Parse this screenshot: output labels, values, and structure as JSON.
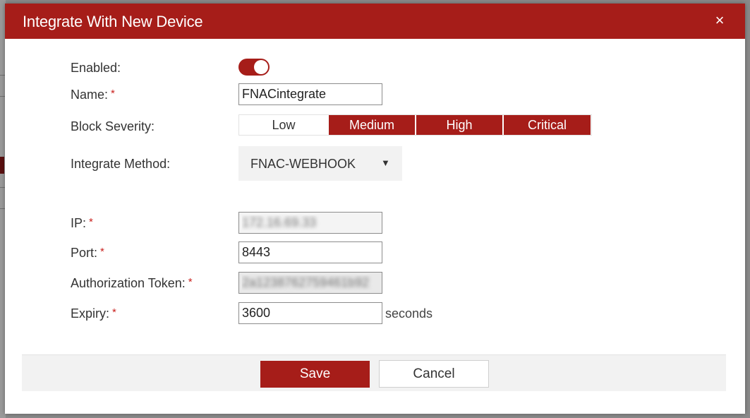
{
  "dialog": {
    "title": "Integrate With New Device",
    "close_label": "×"
  },
  "form": {
    "enabled": {
      "label": "Enabled:",
      "value": true
    },
    "name": {
      "label": "Name:",
      "value": "FNACintegrate"
    },
    "block_severity": {
      "label": "Block Severity:",
      "options": [
        {
          "label": "Low",
          "selected": false
        },
        {
          "label": "Medium",
          "selected": true
        },
        {
          "label": "High",
          "selected": true
        },
        {
          "label": "Critical",
          "selected": true
        }
      ]
    },
    "integrate_method": {
      "label": "Integrate Method:",
      "value": "FNAC-WEBHOOK",
      "caret": "▼"
    },
    "ip": {
      "label": "IP:",
      "value": "172.16.69.33"
    },
    "port": {
      "label": "Port:",
      "value": "8443"
    },
    "auth_token": {
      "label": "Authorization Token:",
      "value": "2a1238762759461b92"
    },
    "expiry": {
      "label": "Expiry:",
      "value": "3600",
      "suffix": "seconds"
    },
    "required_marker": "*"
  },
  "footer": {
    "save_label": "Save",
    "cancel_label": "Cancel"
  },
  "colors": {
    "brand": "#a61d19",
    "footer_bg": "#f2f2f2"
  }
}
